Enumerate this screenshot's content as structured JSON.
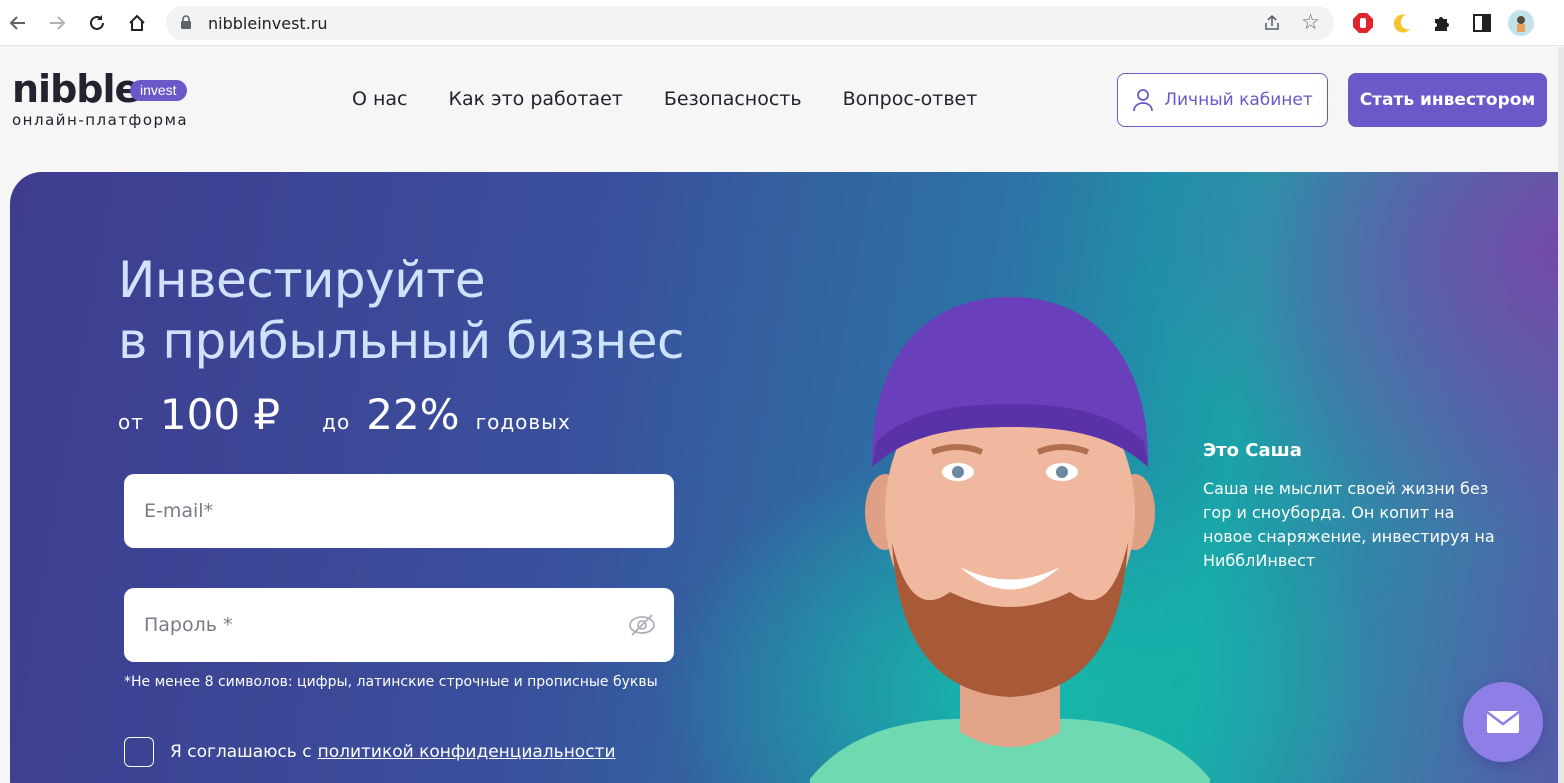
{
  "browser": {
    "url": "nibbleinvest.ru"
  },
  "header": {
    "logo_word": "nibble",
    "logo_badge": "invest",
    "logo_sub": "онлайн-платформа",
    "nav": [
      "О нас",
      "Как это работает",
      "Безопасность",
      "Вопрос-ответ"
    ],
    "cabinet_label": "Личный кабинет",
    "invest_label": "Стать инвестором"
  },
  "hero": {
    "title_line1": "Инвестируйте",
    "title_line2": "в прибыльный бизнес",
    "from_label": "от",
    "from_value": "100 ₽",
    "to_label": "до",
    "to_value": "22%",
    "per_year": "годовых",
    "email_placeholder": "E-mail*",
    "password_placeholder": "Пароль *",
    "password_hint": "*Не менее 8 символов: цифры, латинские строчные и прописные буквы",
    "agree_text": "Я соглашаюсь с",
    "agree_link": "политикой конфиденциальности",
    "caption_title": "Это Саша",
    "caption_text": "Саша не мыслит своей жизни без гор и сноуборда. Он копит на новое снаряжение, инвестируя на НибблИнвест"
  },
  "colors": {
    "brand": "#6b58c9",
    "headline": "#cfe3ff"
  }
}
